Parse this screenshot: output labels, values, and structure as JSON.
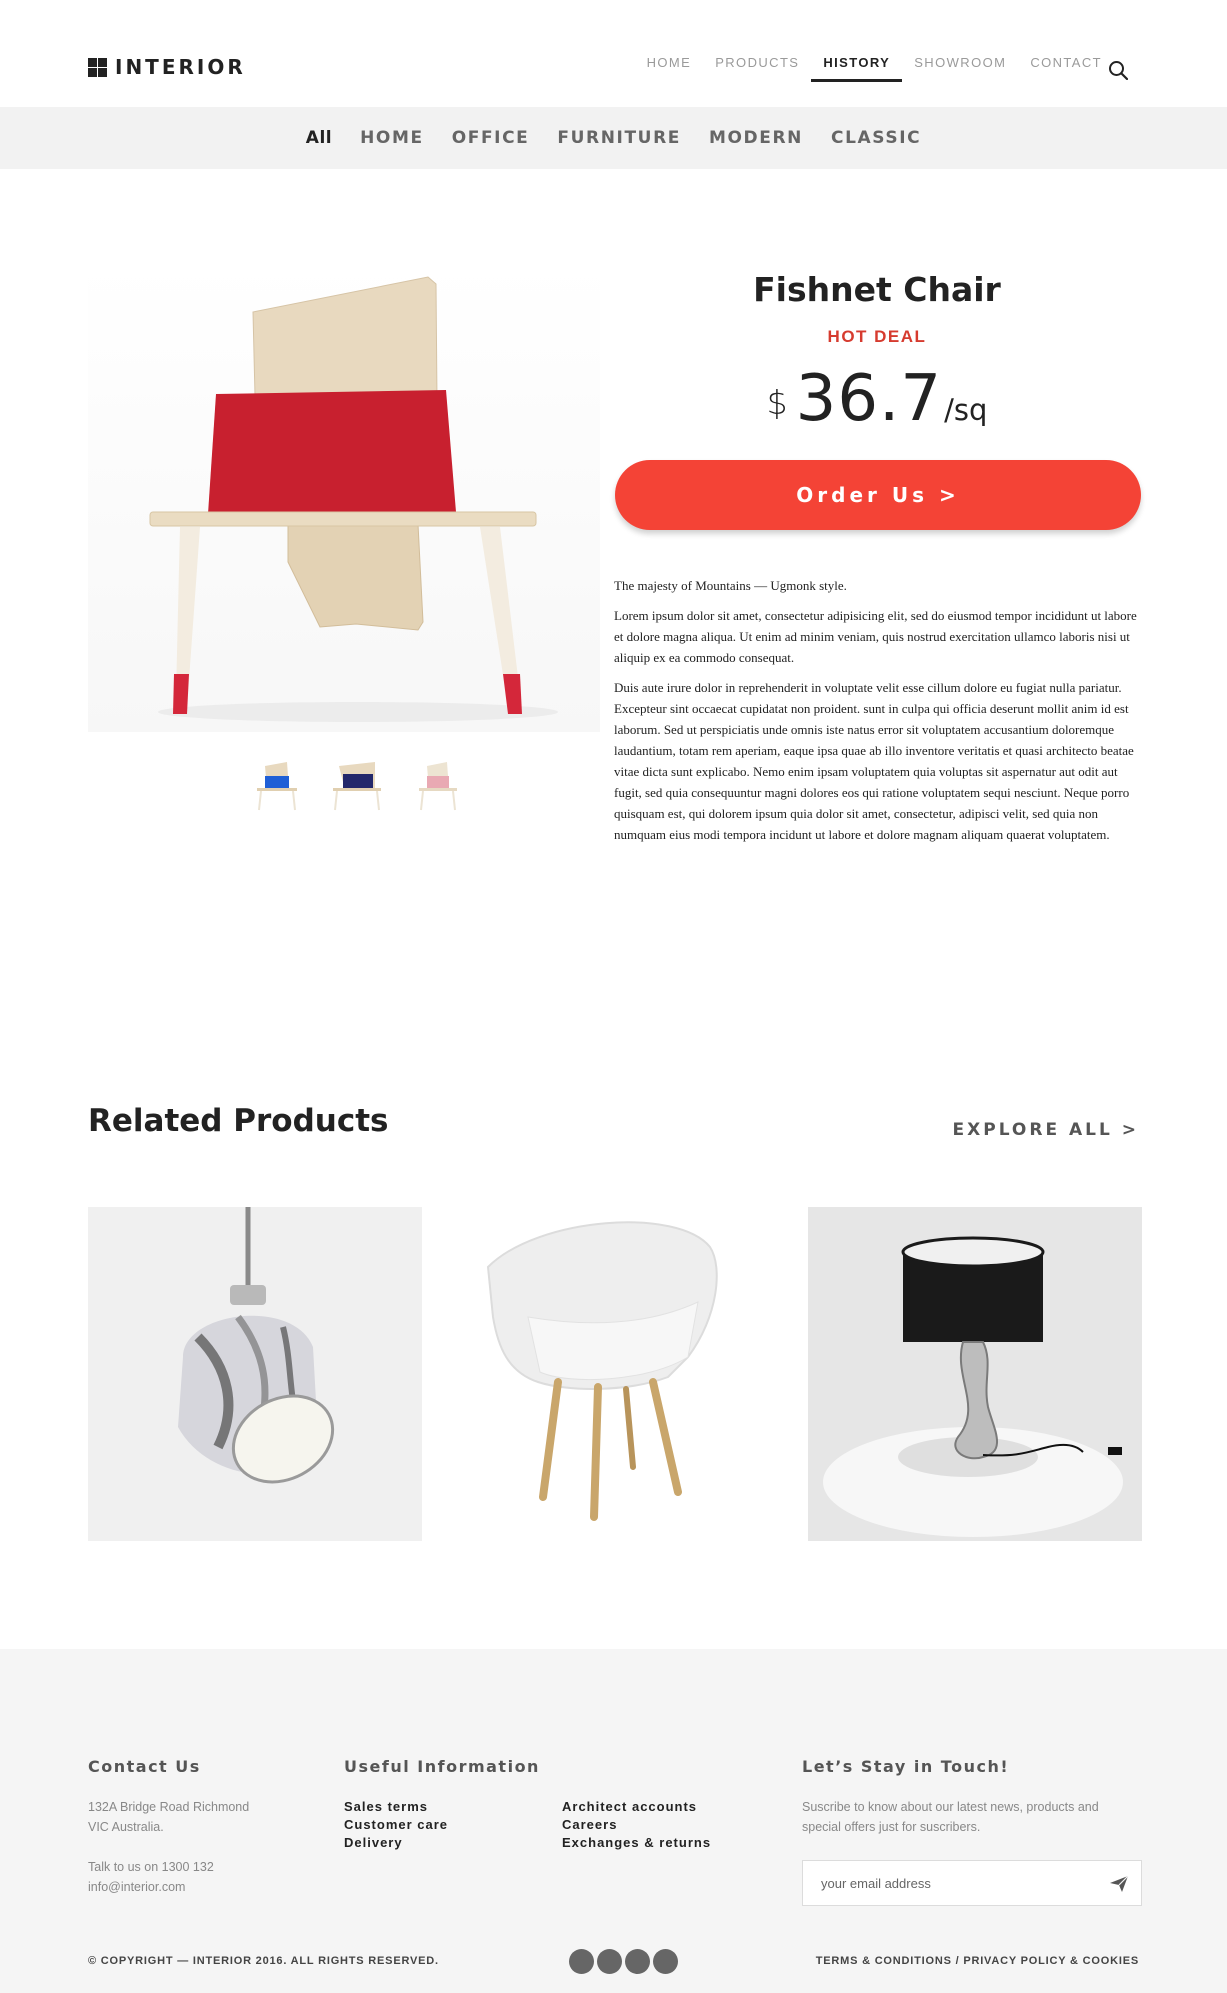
{
  "brand": {
    "name": "INTERIOR"
  },
  "nav": {
    "items": [
      {
        "label": "HOME"
      },
      {
        "label": "PRODUCTS"
      },
      {
        "label": "HISTORY",
        "active": true
      },
      {
        "label": "SHOWROOM"
      },
      {
        "label": "CONTACT"
      }
    ],
    "search_icon": "search-icon"
  },
  "categories": [
    {
      "label": "All",
      "active": true
    },
    {
      "label": "HOME"
    },
    {
      "label": "OFFICE"
    },
    {
      "label": "FURNITURE"
    },
    {
      "label": "MODERN"
    },
    {
      "label": "CLASSIC"
    }
  ],
  "product": {
    "title": "Fishnet Chair",
    "badge": "HOT DEAL",
    "price_currency": "$",
    "price_amount": "36.7",
    "price_unit": "/sq",
    "order_label": "Order Us >",
    "description": [
      "The majesty of Mountains — Ugmonk style.",
      "Lorem ipsum dolor sit amet, consectetur adipisicing elit, sed do eiusmod tempor incididunt ut labore et dolore magna aliqua. Ut enim ad minim veniam, quis nostrud exercitation ullamco laboris nisi ut aliquip ex ea commodo consequat.",
      "Duis aute irure dolor in reprehenderit in voluptate velit esse cillum dolore eu fugiat nulla pariatur. Excepteur sint occaecat cupidatat non proident. sunt in culpa qui officia deserunt mollit anim id est laborum. Sed ut perspiciatis unde omnis iste natus error sit voluptatem accusantium doloremque laudantium, totam rem aperiam, eaque ipsa quae ab illo inventore veritatis et quasi architecto beatae vitae dicta sunt explicabo. Nemo enim ipsam voluptatem quia voluptas sit aspernatur aut odit aut fugit, sed quia consequuntur magni dolores eos qui ratione voluptatem sequi nesciunt. Neque porro quisquam est, qui dolorem ipsum quia dolor sit amet, consectetur, adipisci velit, sed quia non numquam eius modi tempora incidunt ut labore et dolore magnam aliquam quaerat voluptatem."
    ],
    "colors": {
      "seat_red": "#c8202f",
      "wood": "#e8d9bf",
      "accent": "#f44336"
    },
    "thumbnails": [
      {
        "seat_color": "#1f5fd6"
      },
      {
        "seat_color": "#23286b"
      },
      {
        "seat_color": "#e9a9b3"
      }
    ]
  },
  "related": {
    "title": "Related Products",
    "explore_label": "EXPLORE ALL >",
    "items": [
      {
        "name": "pendant-lamp"
      },
      {
        "name": "white-shell-chair"
      },
      {
        "name": "black-table-lamp"
      }
    ]
  },
  "footer": {
    "contact": {
      "heading": "Contact Us",
      "address_line1": "132A Bridge Road Richmond",
      "address_line2": "VIC Australia.",
      "phone": "Talk to us on 1300 132",
      "email": "info@interior.com"
    },
    "useful": {
      "heading": "Useful Information",
      "col1": [
        "Sales terms",
        "Customer care",
        "Delivery"
      ],
      "col2": [
        "Architect accounts",
        "Careers",
        "Exchanges & returns"
      ]
    },
    "newsletter": {
      "heading": "Let’s Stay in Touch!",
      "text_line1": "Suscribe to know about our latest news, products and",
      "text_line2": "special offers just for suscribers.",
      "placeholder": "your email address",
      "send_icon": "send-icon"
    },
    "copyright": "© COPYRIGHT — INTERIOR 2016. ALL RIGHTS RESERVED.",
    "legal": "TERMS & CONDITIONS / PRIVACY POLICY & COOKIES",
    "socials": [
      "social-icon-1",
      "social-icon-2",
      "social-icon-3",
      "social-icon-4"
    ]
  }
}
